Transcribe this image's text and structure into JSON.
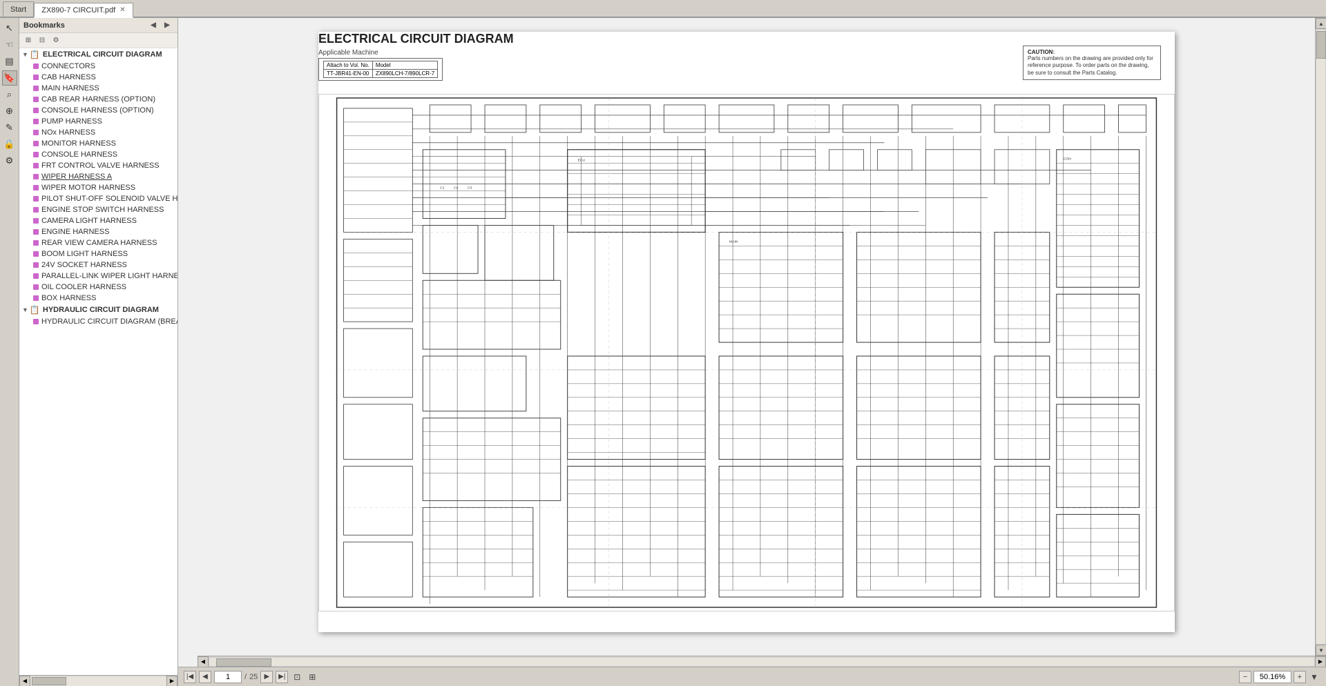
{
  "tabs": [
    {
      "label": "Start",
      "active": false,
      "closeable": false
    },
    {
      "label": "ZX890-7 CIRCUIT.pdf",
      "active": true,
      "closeable": true
    }
  ],
  "bookmarks": {
    "title": "Bookmarks",
    "toolbar_buttons": [
      "expand-all",
      "collapse-all",
      "options"
    ],
    "items": [
      {
        "id": "electrical",
        "label": "ELECTRICAL CIRCUIT DIAGRAM",
        "level": 0,
        "type": "parent",
        "icon": "doc"
      },
      {
        "id": "connectors",
        "label": "CONNECTORS",
        "level": 1,
        "type": "child",
        "dot": "purple",
        "selected": false
      },
      {
        "id": "cab",
        "label": "CAB HARNESS",
        "level": 1,
        "type": "child",
        "dot": "purple",
        "selected": false
      },
      {
        "id": "main",
        "label": "MAIN HARNESS",
        "level": 1,
        "type": "child",
        "dot": "purple",
        "selected": false
      },
      {
        "id": "cab_rear",
        "label": "CAB REAR HARNESS (OPTION)",
        "level": 1,
        "type": "child",
        "dot": "purple",
        "selected": false
      },
      {
        "id": "console_option",
        "label": "CONSOLE HARNESS (OPTION)",
        "level": 1,
        "type": "child",
        "dot": "purple",
        "selected": false
      },
      {
        "id": "pump",
        "label": "PUMP HARNESS",
        "level": 1,
        "type": "child",
        "dot": "purple",
        "selected": false
      },
      {
        "id": "nox",
        "label": "NOx HARNESS",
        "level": 1,
        "type": "child",
        "dot": "purple",
        "selected": false
      },
      {
        "id": "monitor",
        "label": "MONITOR HARNESS",
        "level": 1,
        "type": "child",
        "dot": "purple",
        "selected": false
      },
      {
        "id": "console",
        "label": "CONSOLE HARNESS",
        "level": 1,
        "type": "child",
        "dot": "purple",
        "selected": false
      },
      {
        "id": "frt_control",
        "label": "FRT CONTROL VALVE HARNESS",
        "level": 1,
        "type": "child",
        "dot": "purple",
        "selected": false
      },
      {
        "id": "wiper_a",
        "label": "WIPER HARNESS A",
        "level": 1,
        "type": "child",
        "dot": "purple",
        "selected": false,
        "underline": true
      },
      {
        "id": "wiper_motor",
        "label": "WIPER MOTOR HARNESS",
        "level": 1,
        "type": "child",
        "dot": "purple",
        "selected": false
      },
      {
        "id": "pilot_shutoff",
        "label": "PILOT SHUT-OFF SOLENOID VALVE H",
        "level": 1,
        "type": "child",
        "dot": "purple",
        "selected": false
      },
      {
        "id": "engine_stop",
        "label": "ENGINE STOP SWITCH HARNESS",
        "level": 1,
        "type": "child",
        "dot": "purple",
        "selected": false
      },
      {
        "id": "camera_light",
        "label": "CAMERA LIGHT HARNESS",
        "level": 1,
        "type": "child",
        "dot": "purple",
        "selected": false
      },
      {
        "id": "engine",
        "label": "ENGINE HARNESS",
        "level": 1,
        "type": "child",
        "dot": "purple",
        "selected": false
      },
      {
        "id": "rear_view",
        "label": "REAR VIEW CAMERA HARNESS",
        "level": 1,
        "type": "child",
        "dot": "purple",
        "selected": false
      },
      {
        "id": "boom_light",
        "label": "BOOM LIGHT HARNESS",
        "level": 1,
        "type": "child",
        "dot": "purple",
        "selected": false
      },
      {
        "id": "socket_24v",
        "label": "24V SOCKET HARNESS",
        "level": 1,
        "type": "child",
        "dot": "purple",
        "selected": false
      },
      {
        "id": "parallel_wiper",
        "label": "PARALLEL-LINK WIPER LIGHT HARNE",
        "level": 1,
        "type": "child",
        "dot": "purple",
        "selected": false
      },
      {
        "id": "oil_cooler",
        "label": "OIL COOLER HARNESS",
        "level": 1,
        "type": "child",
        "dot": "purple",
        "selected": false
      },
      {
        "id": "box",
        "label": "BOX HARNESS",
        "level": 1,
        "type": "child",
        "dot": "purple",
        "selected": false
      },
      {
        "id": "hydraulic",
        "label": "HYDRAULIC CIRCUIT DIAGRAM",
        "level": 0,
        "type": "parent",
        "icon": "doc"
      },
      {
        "id": "hydraulic_brea",
        "label": "HYDRAULIC CIRCUIT DIAGRAM (BREA",
        "level": 1,
        "type": "child",
        "dot": "purple",
        "selected": false
      }
    ]
  },
  "pdf": {
    "title": "ELECTRICAL CIRCUIT DIAGRAM",
    "subtitle1": "Applicable Machine",
    "attach_label": "Attach to Vol. No.",
    "model_label": "Model",
    "model_value": "ZX890LCH-7/890LCR-7",
    "attach_value": "TT-JBR41-EN-00",
    "caution_title": "CAUTION:",
    "caution_text": "Parts numbers on the drawing are provided only for reference purpose. To order parts on the drawing, be sure to consult the Parts Catalog."
  },
  "nav": {
    "current_page": "1",
    "total_pages": "25",
    "zoom": "50.16%"
  },
  "left_tools": [
    {
      "name": "cursor",
      "icon": "↖",
      "active": false
    },
    {
      "name": "hand",
      "icon": "✋",
      "active": false
    },
    {
      "name": "page",
      "icon": "📄",
      "active": false
    },
    {
      "name": "bookmarks",
      "icon": "🔖",
      "active": true
    },
    {
      "name": "search",
      "icon": "🔍",
      "active": false
    },
    {
      "name": "zoom",
      "icon": "🔎",
      "active": false
    },
    {
      "name": "annotation",
      "icon": "✏️",
      "active": false
    },
    {
      "name": "lock",
      "icon": "🔒",
      "active": false
    },
    {
      "name": "tools",
      "icon": "⚒",
      "active": false
    }
  ]
}
